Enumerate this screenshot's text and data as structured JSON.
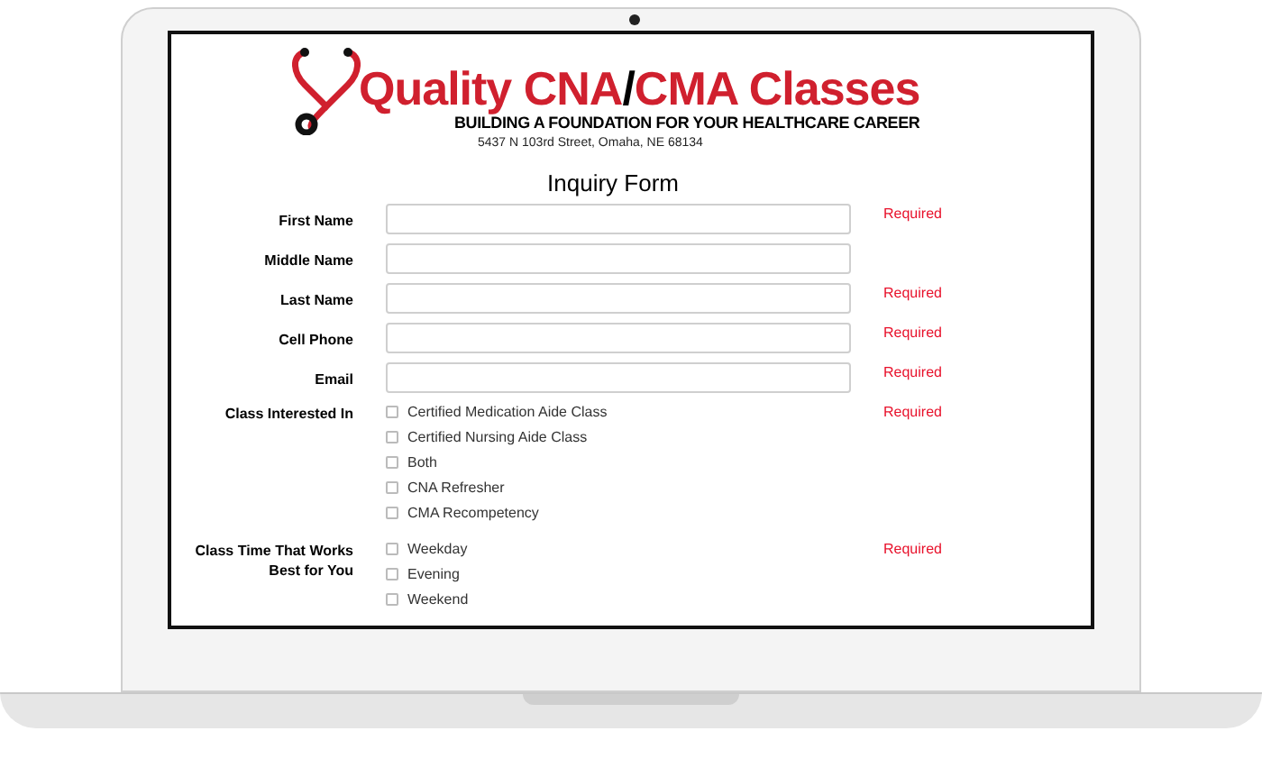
{
  "header": {
    "title_parts": [
      {
        "text": "Quality CNA",
        "kind": "accent"
      },
      {
        "text": "/",
        "kind": "plain"
      },
      {
        "text": "CMA Classes",
        "kind": "accent"
      }
    ],
    "tagline": "BUILDING A FOUNDATION FOR YOUR HEALTHCARE CAREER",
    "address": "5437 N 103rd Street, Omaha, NE 68134"
  },
  "form": {
    "title": "Inquiry Form",
    "fields": [
      {
        "kind": "text",
        "label": "First Name",
        "required": "Required"
      },
      {
        "kind": "text",
        "label": "Middle Name"
      },
      {
        "kind": "text",
        "label": "Last Name",
        "required": "Required"
      },
      {
        "kind": "text",
        "label": "Cell Phone",
        "required": "Required"
      },
      {
        "kind": "text",
        "label": "Email",
        "required": "Required"
      },
      {
        "kind": "checkboxes",
        "label": "Class Interested In",
        "required": "Required",
        "options": [
          {
            "label": "Certified Medication Aide Class",
            "checked": false
          },
          {
            "label": "Certified Nursing Aide Class",
            "checked": false
          },
          {
            "label": "Both",
            "checked": false
          },
          {
            "label": "CNA Refresher",
            "checked": false
          },
          {
            "label": "CMA Recompetency",
            "checked": false
          }
        ]
      },
      {
        "kind": "checkboxes",
        "label": "Class Time That Works Best for You",
        "required": "Required",
        "options": [
          {
            "label": "Weekday",
            "checked": false
          },
          {
            "label": "Evening",
            "checked": false
          },
          {
            "label": "Weekend",
            "checked": false
          }
        ]
      }
    ]
  }
}
